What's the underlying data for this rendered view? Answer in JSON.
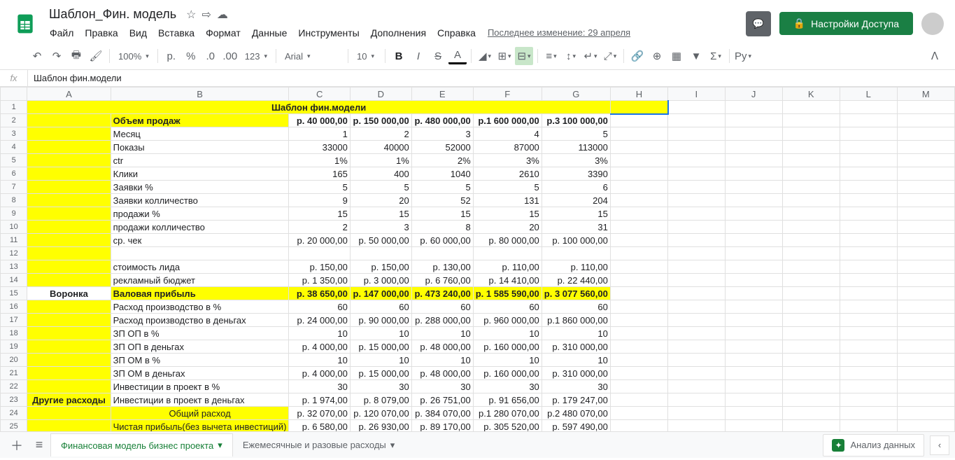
{
  "doc": {
    "title": "Шаблон_Фин. модель"
  },
  "menu": {
    "file": "Файл",
    "edit": "Правка",
    "view": "Вид",
    "insert": "Вставка",
    "format": "Формат",
    "data": "Данные",
    "tools": "Инструменты",
    "addons": "Дополнения",
    "help": "Справка",
    "lastEdit": "Последнее изменение: 29 апреля"
  },
  "share": {
    "button": "Настройки Доступа"
  },
  "toolbar": {
    "zoom": "100%",
    "currency": "р.",
    "percent": "%",
    "numfmt": "123",
    "font": "Arial",
    "size": "10"
  },
  "formula": {
    "value": "Шаблон фин.модели"
  },
  "cols": [
    "A",
    "B",
    "C",
    "D",
    "E",
    "F",
    "G",
    "H",
    "I",
    "J",
    "K",
    "L",
    "M"
  ],
  "rows": [
    {
      "n": "1",
      "cls": "title",
      "cells": {
        "A": "Шаблон фин.модели"
      }
    },
    {
      "n": "2",
      "cells": {
        "A": "",
        "B": "Объем продаж",
        "C": "р.     40 000,00",
        "D": "р.    150 000,00",
        "E": "р.    480 000,00",
        "F": "р.1 600 000,00",
        "G": "р.3 100 000,00"
      },
      "yellowB": true,
      "boldRow": true
    },
    {
      "n": "3",
      "cells": {
        "B": "Месяц",
        "C": "1",
        "D": "2",
        "E": "3",
        "F": "4",
        "G": "5"
      }
    },
    {
      "n": "4",
      "cells": {
        "B": "Показы",
        "C": "33000",
        "D": "40000",
        "E": "52000",
        "F": "87000",
        "G": "113000"
      }
    },
    {
      "n": "5",
      "cells": {
        "B": "ctr",
        "C": "1%",
        "D": "1%",
        "E": "2%",
        "F": "3%",
        "G": "3%"
      }
    },
    {
      "n": "6",
      "cells": {
        "B": "Клики",
        "C": "165",
        "D": "400",
        "E": "1040",
        "F": "2610",
        "G": "3390"
      }
    },
    {
      "n": "7",
      "cells": {
        "B": "Заявки %",
        "C": "5",
        "D": "5",
        "E": "5",
        "F": "5",
        "G": "6"
      }
    },
    {
      "n": "8",
      "cells": {
        "B": "Заявки колличество",
        "C": "9",
        "D": "20",
        "E": "52",
        "F": "131",
        "G": "204"
      }
    },
    {
      "n": "9",
      "cells": {
        "B": "продажи %",
        "C": "15",
        "D": "15",
        "E": "15",
        "F": "15",
        "G": "15"
      }
    },
    {
      "n": "10",
      "cells": {
        "B": "продажи колличество",
        "C": "2",
        "D": "3",
        "E": "8",
        "F": "20",
        "G": "31"
      }
    },
    {
      "n": "11",
      "cells": {
        "B": "ср. чек",
        "C": "р.     20 000,00",
        "D": "р.     50 000,00",
        "E": "р.     60 000,00",
        "F": "р.     80 000,00",
        "G": "р.    100 000,00"
      }
    },
    {
      "n": "12",
      "cells": {}
    },
    {
      "n": "13",
      "cells": {
        "B": "стоимость лида",
        "C": "р.         150,00",
        "D": "р.         150,00",
        "E": "р.         130,00",
        "F": "р.         110,00",
        "G": "р.         110,00"
      }
    },
    {
      "n": "14",
      "cells": {
        "B": "рекламный бюджет",
        "C": "р.       1 350,00",
        "D": "р.       3 000,00",
        "E": "р.       6 760,00",
        "F": "р.     14 410,00",
        "G": "р.     22 440,00"
      }
    },
    {
      "n": "15",
      "cells": {
        "A": "Воронка",
        "B": "Валовая прибыль",
        "C": "р.     38 650,00",
        "D": "р.    147 000,00",
        "E": "р.    473 240,00",
        "F": "р. 1 585 590,00",
        "G": "р. 3 077 560,00"
      },
      "yellowRow": true,
      "boldRow": true
    },
    {
      "n": "16",
      "cells": {
        "B": "Расход производство в %",
        "C": "60",
        "D": "60",
        "E": "60",
        "F": "60",
        "G": "60"
      }
    },
    {
      "n": "17",
      "cells": {
        "B": "Расход производство в деньгах",
        "C": "р.     24 000,00",
        "D": "р.     90 000,00",
        "E": "р.    288 000,00",
        "F": "р.    960 000,00",
        "G": "р.1 860 000,00"
      }
    },
    {
      "n": "18",
      "cells": {
        "B": "ЗП ОП в %",
        "C": "10",
        "D": "10",
        "E": "10",
        "F": "10",
        "G": "10"
      }
    },
    {
      "n": "19",
      "cells": {
        "B": "ЗП ОП в деньгах",
        "C": "р.       4 000,00",
        "D": "р.     15 000,00",
        "E": "р.     48 000,00",
        "F": "р.    160 000,00",
        "G": "р.    310 000,00"
      }
    },
    {
      "n": "20",
      "cells": {
        "B": "ЗП ОМ в %",
        "C": "10",
        "D": "10",
        "E": "10",
        "F": "10",
        "G": "10"
      }
    },
    {
      "n": "21",
      "cells": {
        "B": "ЗП ОМ в деньгах",
        "C": "р.       4 000,00",
        "D": "р.     15 000,00",
        "E": "р.     48 000,00",
        "F": "р.    160 000,00",
        "G": "р.    310 000,00"
      }
    },
    {
      "n": "22",
      "cells": {
        "B": "Инвестиции в проект в %",
        "C": "30",
        "D": "30",
        "E": "30",
        "F": "30",
        "G": "30"
      }
    },
    {
      "n": "23",
      "cells": {
        "A": "Другие расходы",
        "B": "Инвестиции в проект в деньгах",
        "C": "р.       1 974,00",
        "D": "р.       8 079,00",
        "E": "р.     26 751,00",
        "F": "р.     91 656,00",
        "G": "р.    179 247,00"
      },
      "boldA": true
    },
    {
      "n": "24",
      "cells": {
        "B": "Общий расход",
        "C": "р.     32 070,00",
        "D": "р.    120 070,00",
        "E": "р.    384 070,00",
        "F": "р.1 280 070,00",
        "G": "р.2 480 070,00"
      },
      "yellowAB": true,
      "centerB": true
    },
    {
      "n": "25",
      "cells": {
        "B": "Чистая прибыль(без вычета инвестиций)",
        "C": "р.       6 580,00",
        "D": "р.     26 930,00",
        "E": "р.     89 170,00",
        "F": "р.    305 520,00",
        "G": "р.    597 490,00"
      },
      "yellowAB": true,
      "centerB": true
    }
  ],
  "tabs": {
    "t1": "Финансовая модель бизнес проекта",
    "t2": "Ежемесячные и разовые расходы"
  },
  "explore": "Анализ данных"
}
